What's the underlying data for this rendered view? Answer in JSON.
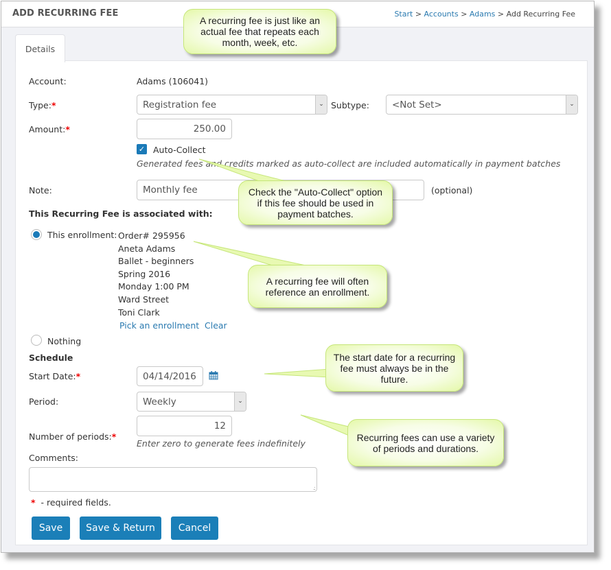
{
  "header": {
    "title": "ADD RECURRING FEE",
    "breadcrumb": {
      "items": [
        {
          "label": "Start",
          "link": true
        },
        {
          "label": "Accounts",
          "link": true
        },
        {
          "label": "Adams",
          "link": true
        },
        {
          "label": "Add Recurring Fee",
          "link": false
        }
      ],
      "separator": ">"
    }
  },
  "tabs": [
    {
      "label": "Details",
      "active": true
    }
  ],
  "form": {
    "account": {
      "label": "Account:",
      "value": "Adams (106041)"
    },
    "type": {
      "label": "Type:",
      "value": "Registration fee",
      "required": true
    },
    "subtype": {
      "label": "Subtype:",
      "value": "<Not Set>"
    },
    "amount": {
      "label": "Amount:",
      "value": "250.00",
      "required": true
    },
    "auto_collect": {
      "label": "Auto-Collect",
      "checked": true,
      "hint": "Generated fees and credits marked as auto-collect are included automatically in payment batches"
    },
    "note": {
      "label": "Note:",
      "value": "Monthly fee",
      "suffix": "(optional)"
    },
    "association": {
      "heading": "This Recurring Fee is associated with:",
      "enrollment_option": {
        "label": "This enrollment:",
        "selected": true
      },
      "enrollment_details": [
        "Order# 295956",
        "Aneta Adams",
        "Ballet - beginners",
        "Spring 2016",
        "Monday 1:00 PM",
        "Ward Street",
        "Toni Clark"
      ],
      "pick_link": "Pick an enrollment",
      "clear_link": "Clear",
      "nothing_option": {
        "label": "Nothing",
        "selected": false
      }
    },
    "schedule": {
      "heading": "Schedule",
      "start_date": {
        "label": "Start Date:",
        "value": "04/14/2016",
        "required": true,
        "icon": "calendar-icon"
      },
      "period": {
        "label": "Period:",
        "value": "Weekly"
      },
      "number_of_periods": {
        "label": "Number of periods:",
        "value": "12",
        "required": true,
        "hint": "Enter zero to generate fees indefinitely"
      }
    },
    "comments": {
      "label": "Comments:",
      "value": ""
    },
    "required_note": "- required fields.",
    "required_marker": "*"
  },
  "buttons": {
    "save": "Save",
    "save_return": "Save & Return",
    "cancel": "Cancel"
  },
  "callouts": [
    {
      "text": "A recurring fee is just like an actual fee that repeats each month, week, etc."
    },
    {
      "text": "Check the \"Auto-Collect\" option if this fee should be used in payment batches."
    },
    {
      "text": "A recurring fee will often reference an enrollment."
    },
    {
      "text": "The start date for a recurring fee must always be in the future."
    },
    {
      "text": "Recurring fees can use a variety of periods and durations."
    }
  ],
  "colors": {
    "accent": "#1b7fb8",
    "link": "#2a7ab0",
    "required": "#ee0000",
    "callout_fill": "#e4f8a8"
  }
}
